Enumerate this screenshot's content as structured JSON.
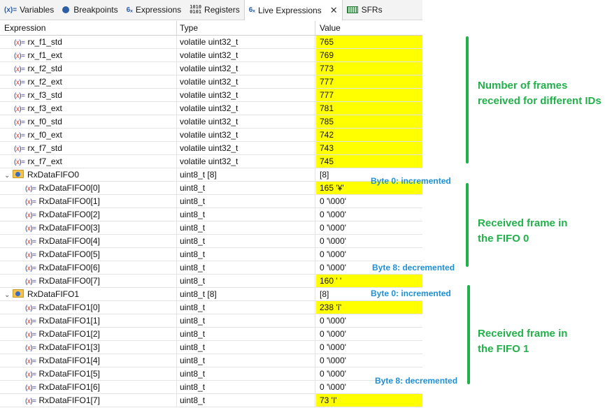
{
  "tabs": [
    {
      "icon": "(x)=",
      "label": "Variables",
      "icon_name": "variables-icon"
    },
    {
      "icon": "",
      "label": "Breakpoints",
      "icon_name": "breakpoints-icon"
    },
    {
      "icon": "6ₓ",
      "label": "Expressions",
      "icon_name": "expressions-icon"
    },
    {
      "icon": "1010\n0101",
      "label": "Registers",
      "icon_name": "registers-icon"
    },
    {
      "icon": "6ₓ",
      "label": "Live Expressions",
      "icon_name": "live-expressions-icon",
      "active": true
    },
    {
      "icon": "",
      "label": "SFRs",
      "icon_name": "sfrs-icon"
    }
  ],
  "columns": {
    "expression": "Expression",
    "type": "Type",
    "value": "Value"
  },
  "rows": [
    {
      "name": "rx_f1_std",
      "type": "volatile uint32_t",
      "value": "765",
      "hl": true
    },
    {
      "name": "rx_f1_ext",
      "type": "volatile uint32_t",
      "value": "769",
      "hl": true
    },
    {
      "name": "rx_f2_std",
      "type": "volatile uint32_t",
      "value": "773",
      "hl": true
    },
    {
      "name": "rx_f2_ext",
      "type": "volatile uint32_t",
      "value": "777",
      "hl": true
    },
    {
      "name": "rx_f3_std",
      "type": "volatile uint32_t",
      "value": "777",
      "hl": true
    },
    {
      "name": "rx_f3_ext",
      "type": "volatile uint32_t",
      "value": "781",
      "hl": true
    },
    {
      "name": "rx_f0_std",
      "type": "volatile uint32_t",
      "value": "785",
      "hl": true
    },
    {
      "name": "rx_f0_ext",
      "type": "volatile uint32_t",
      "value": "742",
      "hl": true
    },
    {
      "name": "rx_f7_std",
      "type": "volatile uint32_t",
      "value": "743",
      "hl": true
    },
    {
      "name": "rx_f7_ext",
      "type": "volatile uint32_t",
      "value": "745",
      "hl": true
    },
    {
      "name": "RxDataFIFO0",
      "type": "uint8_t [8]",
      "value": "[8]",
      "parent": true
    },
    {
      "name": "RxDataFIFO0[0]",
      "type": "uint8_t",
      "value": "165 '¥'",
      "child": true,
      "hl": true
    },
    {
      "name": "RxDataFIFO0[1]",
      "type": "uint8_t",
      "value": "0 '\\000'",
      "child": true
    },
    {
      "name": "RxDataFIFO0[2]",
      "type": "uint8_t",
      "value": "0 '\\000'",
      "child": true
    },
    {
      "name": "RxDataFIFO0[3]",
      "type": "uint8_t",
      "value": "0 '\\000'",
      "child": true
    },
    {
      "name": "RxDataFIFO0[4]",
      "type": "uint8_t",
      "value": "0 '\\000'",
      "child": true
    },
    {
      "name": "RxDataFIFO0[5]",
      "type": "uint8_t",
      "value": "0 '\\000'",
      "child": true
    },
    {
      "name": "RxDataFIFO0[6]",
      "type": "uint8_t",
      "value": "0 '\\000'",
      "child": true
    },
    {
      "name": "RxDataFIFO0[7]",
      "type": "uint8_t",
      "value": "160 ' '",
      "child": true,
      "hl": true
    },
    {
      "name": "RxDataFIFO1",
      "type": "uint8_t [8]",
      "value": "[8]",
      "parent": true
    },
    {
      "name": "RxDataFIFO1[0]",
      "type": "uint8_t",
      "value": "238 'î'",
      "child": true,
      "hl": true
    },
    {
      "name": "RxDataFIFO1[1]",
      "type": "uint8_t",
      "value": "0 '\\000'",
      "child": true
    },
    {
      "name": "RxDataFIFO1[2]",
      "type": "uint8_t",
      "value": "0 '\\000'",
      "child": true
    },
    {
      "name": "RxDataFIFO1[3]",
      "type": "uint8_t",
      "value": "0 '\\000'",
      "child": true
    },
    {
      "name": "RxDataFIFO1[4]",
      "type": "uint8_t",
      "value": "0 '\\000'",
      "child": true
    },
    {
      "name": "RxDataFIFO1[5]",
      "type": "uint8_t",
      "value": "0 '\\000'",
      "child": true
    },
    {
      "name": "RxDataFIFO1[6]",
      "type": "uint8_t",
      "value": "0 '\\000'",
      "child": true
    },
    {
      "name": "RxDataFIFO1[7]",
      "type": "uint8_t",
      "value": "73 'I'",
      "child": true,
      "hl": true
    }
  ],
  "annotations": {
    "frames_note": "Number of frames received for different IDs",
    "fifo0_note": "Received frame in the FIFO 0",
    "fifo1_note": "Received frame in the FIFO 1",
    "fifo0_byte0": "Byte 0: incremented",
    "fifo0_byte7": "Byte 8: decremented",
    "fifo1_byte0": "Byte 0: incremented",
    "fifo1_byte7": "Byte 8: decremented"
  },
  "colors": {
    "highlight": "#ffff00",
    "annotation_green": "#22b04b",
    "annotation_blue": "#1f8fd6"
  }
}
